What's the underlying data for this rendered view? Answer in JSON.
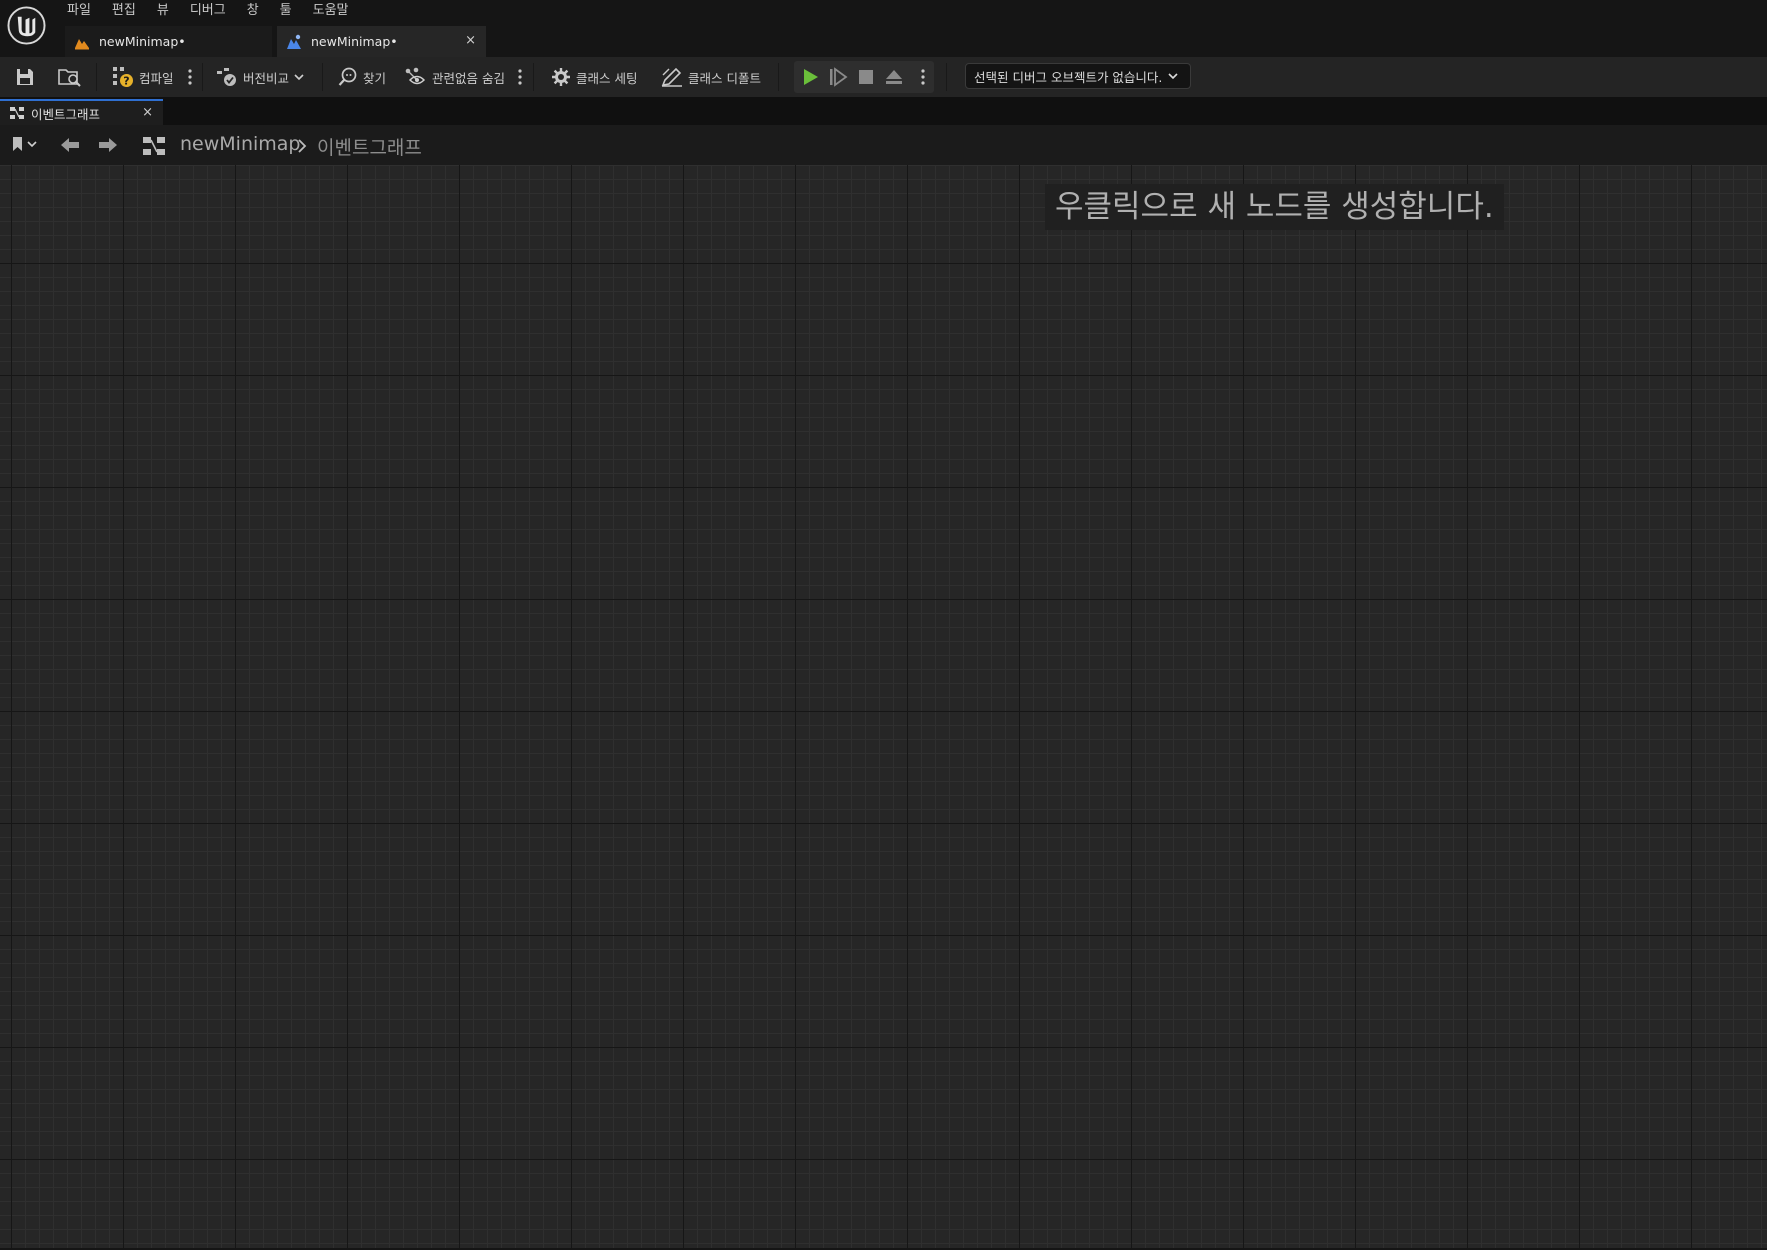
{
  "menu": [
    "파일",
    "편집",
    "뷰",
    "디버그",
    "창",
    "툴",
    "도움말"
  ],
  "doc_tabs": [
    {
      "label": "newMinimap•",
      "icon": "material-icon",
      "active": false
    },
    {
      "label": "newMinimap•",
      "icon": "widget-blueprint-icon",
      "active": true,
      "close": "×"
    }
  ],
  "toolbar": {
    "compile_label": "컴파일",
    "diff_label": "버전비교",
    "find_label": "찾기",
    "hide_unrelated_label": "관련없음 숨김",
    "class_settings_label": "클래스 세팅",
    "class_defaults_label": "클래스 디폴트",
    "debug_object_label": "선택된 디버그 오브젝트가 없습니다."
  },
  "panel_tab": {
    "label": "이벤트그래프",
    "close": "×"
  },
  "breadcrumb": {
    "root": "newMinimap",
    "current": "이벤트그래프"
  },
  "graph": {
    "hint": "우클릭으로 새 노드를 생성합니다."
  },
  "colors": {
    "play_green": "#6abf3a",
    "active_tab_accent": "#2f6fd0",
    "compile_warning": "#e7b12a",
    "material_icon": "#e28a1e",
    "widget_icon": "#4a86e8"
  }
}
